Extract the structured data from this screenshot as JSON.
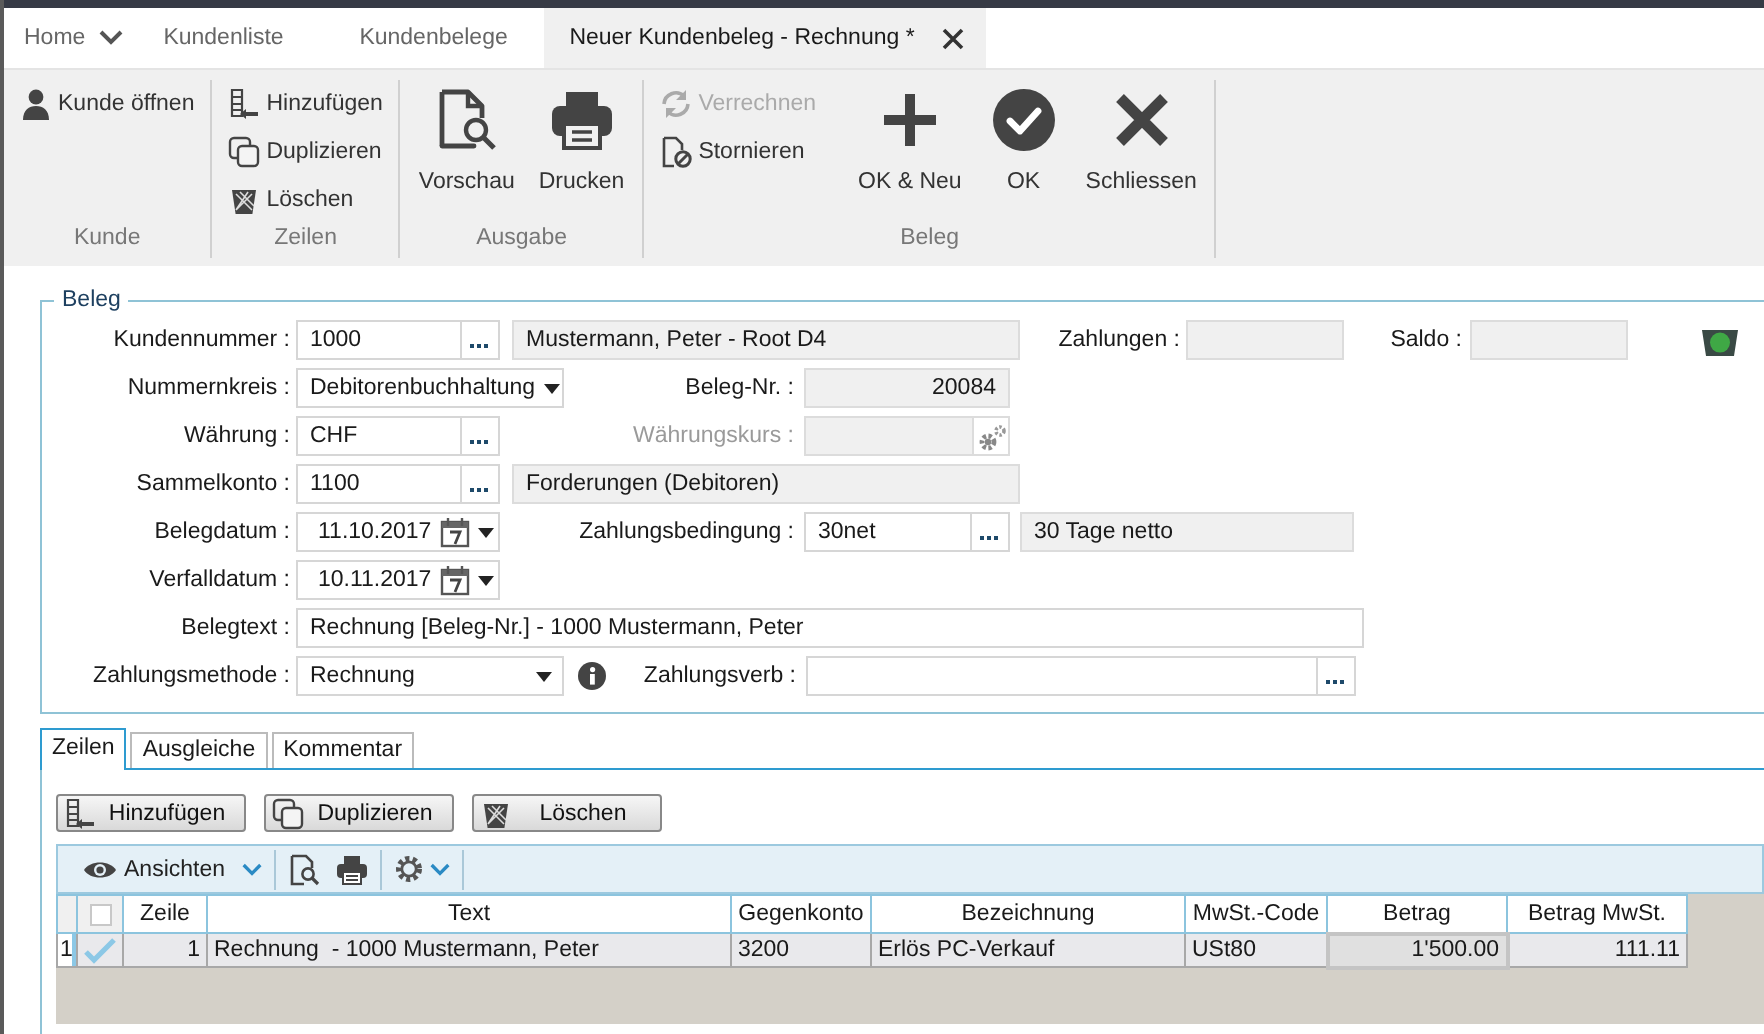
{
  "tabs": [
    {
      "label": "Home",
      "selected": false,
      "kind": "menu"
    },
    {
      "label": "Kundenliste",
      "selected": false,
      "kind": "plain"
    },
    {
      "label": "Kundenbelege",
      "selected": false,
      "kind": "plain"
    },
    {
      "label": "Neuer Kundenbeleg - Rechnung *",
      "selected": true,
      "kind": "closable"
    }
  ],
  "ribbon": {
    "groups": [
      {
        "label": "Kunde",
        "buttons": [
          {
            "label": "Kunde öffnen",
            "kind": "small",
            "disabled": false
          }
        ]
      },
      {
        "label": "Zeilen",
        "buttons": [
          {
            "label": "Hinzufügen",
            "kind": "small",
            "disabled": false
          },
          {
            "label": "Duplizieren",
            "kind": "small",
            "disabled": false
          },
          {
            "label": "Löschen",
            "kind": "small",
            "disabled": false
          }
        ]
      },
      {
        "label": "Ausgabe",
        "buttons": [
          {
            "label": "Vorschau",
            "kind": "large",
            "disabled": false
          },
          {
            "label": "Drucken",
            "kind": "large",
            "disabled": false
          }
        ]
      },
      {
        "label": "Beleg",
        "buttons": [
          {
            "label": "Verrechnen",
            "kind": "small",
            "disabled": true
          },
          {
            "label": "Stornieren",
            "kind": "small",
            "disabled": false
          },
          {
            "label": "OK & Neu",
            "kind": "large",
            "disabled": false
          },
          {
            "label": "OK",
            "kind": "large",
            "disabled": false
          },
          {
            "label": "Schliessen",
            "kind": "large",
            "disabled": false
          }
        ]
      }
    ]
  },
  "form": {
    "title": "Beleg",
    "rows": [
      {
        "items": [
          {
            "kind": "label",
            "text": "Kundennummer :",
            "disabled": false
          },
          {
            "kind": "lookup",
            "value": "1000"
          },
          {
            "kind": "readonly",
            "value": "Mustermann, Peter - Root D4"
          },
          {
            "kind": "label",
            "text": "Zahlungen :",
            "disabled": false
          },
          {
            "kind": "readonly"
          },
          {
            "kind": "label",
            "text": "Saldo :",
            "disabled": false
          },
          {
            "kind": "readonly"
          },
          {
            "kind": "status"
          }
        ]
      },
      {
        "items": [
          {
            "kind": "label",
            "text": "Nummernkreis :",
            "disabled": false
          },
          {
            "kind": "select",
            "value": "Debitorenbuchhaltung"
          },
          {
            "kind": "label",
            "text": "Beleg-Nr. :",
            "disabled": false
          },
          {
            "kind": "number",
            "value": "20084"
          }
        ]
      },
      {
        "items": [
          {
            "kind": "label",
            "text": "Währung :",
            "disabled": false
          },
          {
            "kind": "lookup",
            "value": "CHF"
          },
          {
            "kind": "label",
            "text": "Währungskurs :",
            "disabled": true
          },
          {
            "kind": "readonly"
          },
          {
            "kind": "calc"
          }
        ]
      },
      {
        "items": [
          {
            "kind": "label",
            "text": "Sammelkonto :",
            "disabled": false
          },
          {
            "kind": "lookup",
            "value": "1100"
          },
          {
            "kind": "readonly",
            "value": "Forderungen (Debitoren)"
          }
        ]
      },
      {
        "items": [
          {
            "kind": "label",
            "text": "Belegdatum :",
            "disabled": false
          },
          {
            "kind": "date",
            "value": "11.10.2017"
          },
          {
            "kind": "label",
            "text": "Zahlungsbedingung :",
            "disabled": false
          },
          {
            "kind": "lookup",
            "value": "30net"
          },
          {
            "kind": "readonly",
            "value": "30 Tage netto"
          }
        ]
      },
      {
        "items": [
          {
            "kind": "label",
            "text": "Verfalldatum :",
            "disabled": false
          },
          {
            "kind": "date",
            "value": "10.11.2017"
          }
        ]
      },
      {
        "items": [
          {
            "kind": "label",
            "text": "Belegtext :",
            "disabled": false
          },
          {
            "kind": "text",
            "value": "Rechnung [Beleg-Nr.] - 1000 Mustermann, Peter"
          }
        ]
      },
      {
        "items": [
          {
            "kind": "label",
            "text": "Zahlungsmethode :",
            "disabled": false
          },
          {
            "kind": "select",
            "value": "Rechnung"
          },
          {
            "kind": "info"
          },
          {
            "kind": "label",
            "text": "Zahlungsverb :",
            "disabled": false
          },
          {
            "kind": "lookup"
          }
        ]
      }
    ]
  },
  "detail_tabs": [
    {
      "label": "Zeilen",
      "selected": true
    },
    {
      "label": "Ausgleiche",
      "selected": false
    },
    {
      "label": "Kommentar",
      "selected": false
    }
  ],
  "line_buttons": [
    "Hinzufügen",
    "Duplizieren",
    "Löschen"
  ],
  "grid_toolbar": {
    "views": "Ansichten"
  },
  "table": {
    "select_all": {
      "checked": false
    },
    "columns": [
      "Zeile",
      "Text",
      "Gegenkonto",
      "Bezeichnung",
      "MwSt.-Code",
      "Betrag",
      "Betrag MwSt."
    ],
    "rows": [
      {
        "number": "1",
        "selected": true,
        "checked": true,
        "cells": [
          "1",
          "Rechnung  - 1000 Mustermann, Peter",
          "3200",
          "Erlös PC-Verkauf",
          "USt80",
          "1'500.00",
          "111.11"
        ]
      }
    ]
  }
}
